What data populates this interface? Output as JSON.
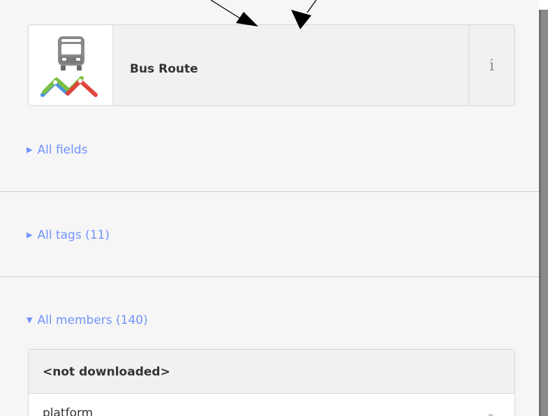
{
  "preset": {
    "name": "Bus Route",
    "info_label": "i",
    "icon": "bus-route-icon"
  },
  "sections": {
    "all_fields": "All fields",
    "all_tags": "All tags (11)",
    "all_members": "All members (140)"
  },
  "members": {
    "header": "<not downloaded>",
    "role_value": "platform"
  },
  "colors": {
    "link": "#7092ff",
    "panel_bg": "#f6f6f6",
    "route_red": "#e0463d",
    "route_green": "#7bc043",
    "route_blue": "#4a90e2"
  }
}
